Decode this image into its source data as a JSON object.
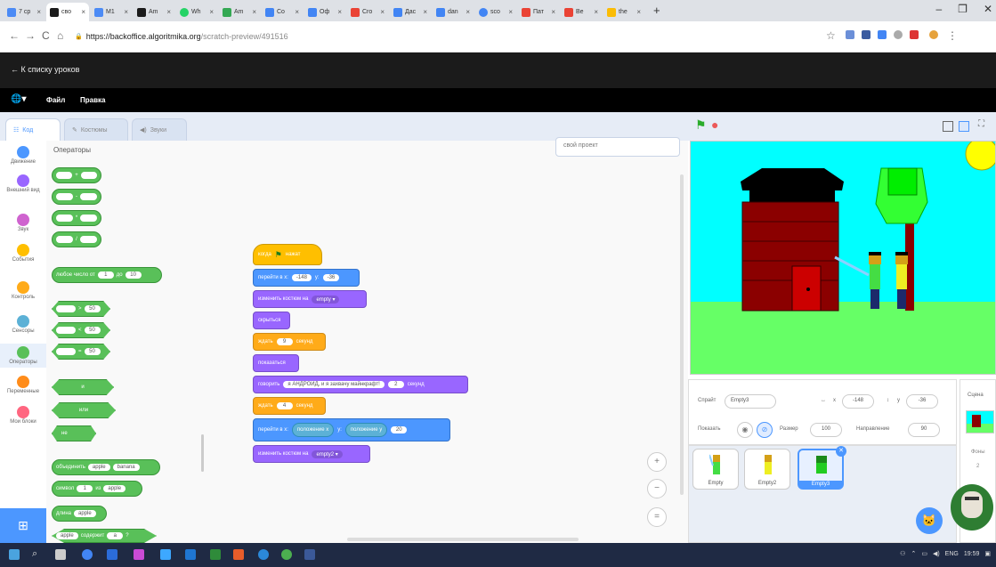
{
  "browser": {
    "tabs": [
      {
        "label": "7 ср",
        "color": "#4c8bf5"
      },
      {
        "label": "сво",
        "color": "#1b1b1b"
      },
      {
        "label": "M1",
        "color": "#4c8bf5"
      },
      {
        "label": "Am",
        "color": "#1b1b1b"
      },
      {
        "label": "Wh",
        "color": "#25d366"
      },
      {
        "label": "Am",
        "color": "#34a853"
      },
      {
        "label": "Co",
        "color": "#4285f4"
      },
      {
        "label": "Оф",
        "color": "#4285f4"
      },
      {
        "label": "Cro",
        "color": "#ea4335"
      },
      {
        "label": "Дас",
        "color": "#4285f4"
      },
      {
        "label": "dan",
        "color": "#4285f4"
      },
      {
        "label": "sco",
        "color": "#4285f4"
      },
      {
        "label": "Пат",
        "color": "#ea4335"
      },
      {
        "label": "Ве",
        "color": "#ea4335"
      },
      {
        "label": "the",
        "color": "#fbbc05"
      }
    ],
    "new_tab": "+",
    "minimize": "–",
    "maximize": "❐",
    "close": "✕",
    "back": "←",
    "forward": "→",
    "reload": "C",
    "home": "⌂",
    "lock": "🔒",
    "url_host": "https://backoffice.algoritmika.org",
    "url_path": "/scratch-preview/491516",
    "star": "☆",
    "menu": "⋮"
  },
  "scratch": {
    "back_link": "← К списку уроков",
    "globe": "🌐▾",
    "menu_file": "Файл",
    "menu_edit": "Правка",
    "tab_code": "Код",
    "tab_costumes": "Костюмы",
    "tab_sounds": "Звуки",
    "project_name": "свой проект",
    "categories": [
      {
        "label": "Движение",
        "color": "#4c97ff"
      },
      {
        "label": "Внешний вид",
        "color": "#9966ff"
      },
      {
        "label": "Звук",
        "color": "#cf63cf"
      },
      {
        "label": "События",
        "color": "#ffbf00"
      },
      {
        "label": "Контроль",
        "color": "#ffab19"
      },
      {
        "label": "Сенсоры",
        "color": "#5cb1d6"
      },
      {
        "label": "Операторы",
        "color": "#59c059"
      },
      {
        "label": "Переменные",
        "color": "#ff8c1a"
      },
      {
        "label": "Мои блоки",
        "color": "#ff6680"
      }
    ],
    "palette_title": "Операторы",
    "palette": {
      "plus": "+",
      "minus": "-",
      "times": "*",
      "divide": "/",
      "random_label": "любое число от",
      "random_from": "1",
      "random_to_label": "до",
      "random_to": "10",
      "gt": ">",
      "lt": "<",
      "eq": "=",
      "cmp_value": "50",
      "and": "и",
      "or": "или",
      "not": "не",
      "join_label": "объединить",
      "join_a": "apple",
      "join_b": "banana",
      "letter_label": "символ",
      "letter_n": "1",
      "letter_of": "из",
      "letter_word": "apple",
      "length_label": "длина",
      "length_word": "apple",
      "contains_word": "apple",
      "contains_label": "содержит",
      "contains_value": "a",
      "contains_q": "?"
    },
    "script": {
      "hat_label": "когда",
      "hat_flag": "⚑",
      "hat_suffix": "нажат",
      "goto_label": "перейти в x:",
      "goto_x": "-148",
      "goto_y_label": "y:",
      "goto_y": "-36",
      "costume_label": "изменить костюм на",
      "costume_value": "empty ▾",
      "hide_label": "скрыться",
      "wait1_label": "ждать",
      "wait1_value": "9",
      "wait1_suffix": "секунд",
      "show_label": "показаться",
      "say_label": "говорить",
      "say_text": "я АНДРОИД, и я захвачу майнкрафт!",
      "say_secs": "2",
      "say_suffix": "секунд",
      "wait2_label": "ждать",
      "wait2_value": "4",
      "wait2_suffix": "секунд",
      "goto2_label": "перейти в x:",
      "goto2_x_sensor": "положение x",
      "goto2_y_label": "y:",
      "goto2_y_sensor": "положение y",
      "goto2_y_value": "20",
      "costume2_label": "изменить костюм на",
      "costume2_value": "empty2 ▾"
    },
    "zoom_in": "+",
    "zoom_out": "−",
    "zoom_reset": "=",
    "add_extension": "⊞",
    "green_flag": "⚑",
    "stop": "●",
    "sprite_info": {
      "sprite_label": "Спрайт",
      "sprite_name": "Empty3",
      "x_label": "x",
      "x_value": "-148",
      "y_label": "y",
      "y_value": "-36",
      "show_label": "Показать",
      "size_label": "Размер",
      "size_value": "100",
      "direction_label": "Направление",
      "direction_value": "90"
    },
    "sprites": [
      "Empty",
      "Empty2",
      "Empty3"
    ],
    "stage_panel_title": "Сцена",
    "backdrops_label": "Фоны",
    "backdrops_count": "2"
  },
  "taskbar": {
    "time": "19:59",
    "lang": "ENG"
  }
}
